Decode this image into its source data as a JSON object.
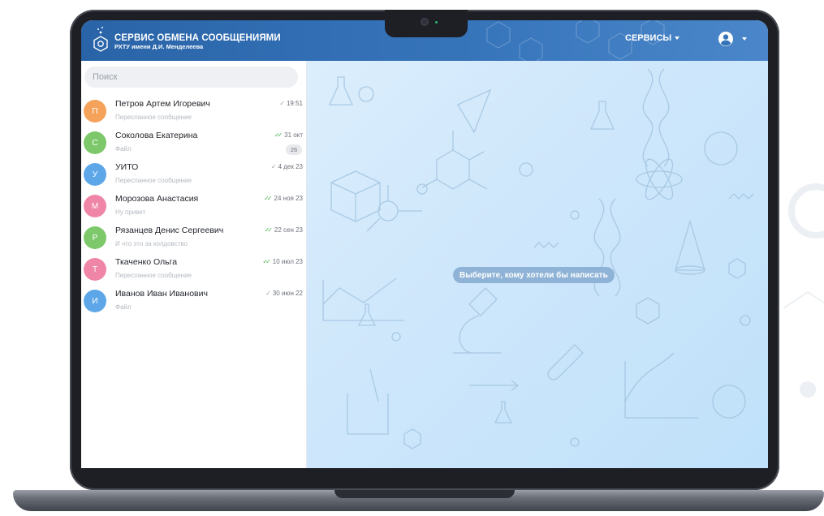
{
  "header": {
    "brand_title": "СЕРВИС ОБМЕНА СООБЩЕНИЯМИ",
    "brand_subtitle": "РХТУ имени Д.И. Менделеева",
    "services_label": "СЕРВИСЫ",
    "account_icon": "user-circle-icon"
  },
  "search": {
    "placeholder": "Поиск"
  },
  "chats": [
    {
      "initial": "П",
      "name": "Петров Артем Игоревич",
      "preview": "Пересланное сообщение",
      "date": "19:51",
      "status": "sent",
      "color": "#f5a25a",
      "unread": ""
    },
    {
      "initial": "С",
      "name": "Соколова Екатерина",
      "preview": "Файл",
      "date": "31 окт",
      "status": "read",
      "color": "#7cc86a",
      "unread": "26"
    },
    {
      "initial": "У",
      "name": "УИТО",
      "preview": "Пересланное сообщение",
      "date": "4 дек 23",
      "status": "sent",
      "color": "#5da7e8",
      "unread": ""
    },
    {
      "initial": "М",
      "name": "Морозова Анастасия",
      "preview": "Ну привет",
      "date": "24 ноя 23",
      "status": "read",
      "color": "#ef86a8",
      "unread": ""
    },
    {
      "initial": "Р",
      "name": "Рязанцев Денис Сергеевич",
      "preview": "И что это за колдовство",
      "date": "22 сен 23",
      "status": "read",
      "color": "#7cc86a",
      "unread": ""
    },
    {
      "initial": "Т",
      "name": "Ткаченко Ольга",
      "preview": "Пересланное сообщение",
      "date": "10 июл 23",
      "status": "read",
      "color": "#ef86a8",
      "unread": ""
    },
    {
      "initial": "И",
      "name": "Иванов Иван Иванович",
      "preview": "Файл",
      "date": "30 июн 22",
      "status": "sent",
      "color": "#5da7e8",
      "unread": ""
    }
  ],
  "main": {
    "empty_hint": "Выберите, кому хотели бы написать"
  },
  "colors": {
    "header": "#3674ba",
    "read_check": "#4caf50",
    "hint_bg": "#8fb3d6"
  }
}
